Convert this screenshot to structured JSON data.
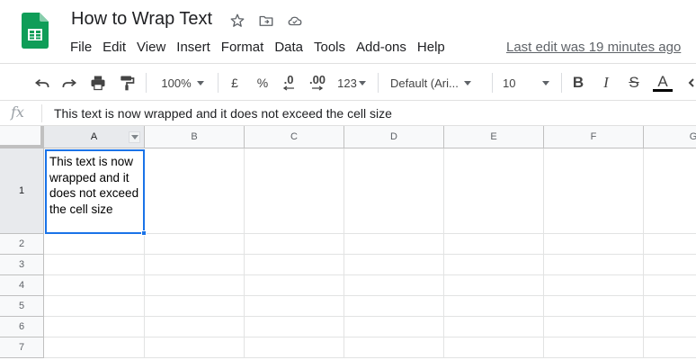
{
  "document": {
    "title": "How to Wrap Text",
    "last_edit": "Last edit was 19 minutes ago"
  },
  "menu": {
    "items": [
      "File",
      "Edit",
      "View",
      "Insert",
      "Format",
      "Data",
      "Tools",
      "Add-ons",
      "Help"
    ]
  },
  "toolbar": {
    "zoom": "100%",
    "currency": "£",
    "percent": "%",
    "decrease_decimal": ".0",
    "increase_decimal": ".00",
    "more_formats": "123",
    "font": "Default (Ari...",
    "font_size": "10",
    "bold": "B",
    "italic": "I",
    "strikethrough": "S",
    "text_color": "A"
  },
  "formula_bar": {
    "fx_label": "fx",
    "content": "This text is now wrapped and it does not exceed the cell size"
  },
  "sheet": {
    "columns": [
      "A",
      "B",
      "C",
      "D",
      "E",
      "F",
      "G"
    ],
    "rows": [
      "1",
      "2",
      "3",
      "4",
      "5",
      "6",
      "7"
    ],
    "cells": {
      "A1": "This text is now wrapped and it does not exceed the cell size"
    }
  },
  "colors": {
    "accent": "#1a73e8",
    "sheets_green": "#0f9d58"
  }
}
